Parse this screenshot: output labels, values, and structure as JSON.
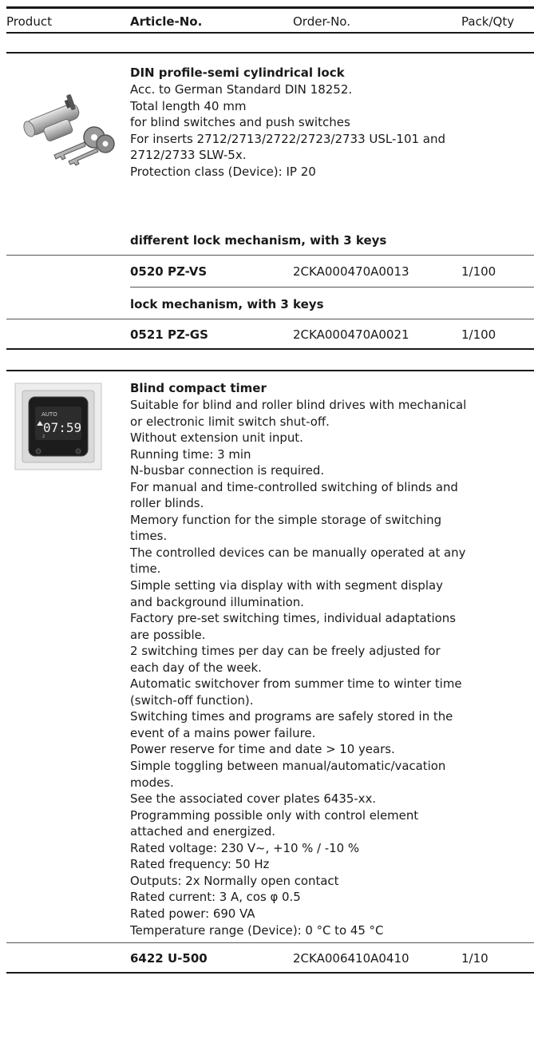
{
  "header": {
    "product": "Product",
    "article": "Article-No.",
    "order": "Order-No.",
    "pack": "Pack/Qty"
  },
  "products": [
    {
      "image_icon": "cylinder-lock-image",
      "title": "DIN profile-semi cylindrical lock",
      "lines": [
        "Acc. to German Standard DIN 18252.",
        "Total length 40 mm",
        "for blind switches and push switches",
        "For inserts 2712/2713/2722/2723/2733 USL-101 and",
        "2712/2733 SLW-5x.",
        "Protection class (Device): IP 20"
      ],
      "variants": [
        {
          "subtitle": "different lock mechanism, with 3 keys",
          "article": "0520 PZ-VS",
          "order": "2CKA000470A0013",
          "pack": "1/100"
        },
        {
          "subtitle": "lock mechanism, with 3 keys",
          "article": "0521 PZ-GS",
          "order": "2CKA000470A0021",
          "pack": "1/100"
        }
      ]
    },
    {
      "image_icon": "blind-timer-image",
      "display_label": "AUTO",
      "display_time": "07:59",
      "title": "Blind compact timer",
      "lines": [
        "Suitable for blind and roller blind drives with mechanical",
        "or electronic limit switch shut-off.",
        "Without extension unit input.",
        "Running time: 3 min",
        "N-busbar connection is required.",
        "For manual and time-controlled switching of blinds and",
        "roller blinds.",
        "Memory function for the simple storage of switching",
        "times.",
        "The controlled devices can be manually operated at any",
        "time.",
        "Simple setting via display with with segment display",
        "and background illumination.",
        "Factory pre-set switching times, individual adaptations",
        "are possible.",
        "2 switching times per day can be freely adjusted for",
        "each day of the week.",
        "Automatic switchover from summer time to winter time",
        "(switch-off function).",
        "Switching times and programs are safely stored in the",
        "event of a mains power failure.",
        "Power reserve for time and date > 10 years.",
        "Simple toggling between manual/automatic/vacation",
        "modes.",
        "See the associated cover plates 6435-xx.",
        "Programming possible only with control element",
        "attached and energized.",
        "Rated voltage: 230 V~, +10 % / -10 %",
        "Rated frequency: 50 Hz",
        "Outputs: 2x Normally open contact",
        "Rated current: 3 A, cos φ 0.5",
        "Rated power: 690 VA",
        "Temperature range (Device): 0 °C to 45 °C"
      ],
      "variants": [
        {
          "article": "6422 U-500",
          "order": "2CKA006410A0410",
          "pack": "1/10"
        }
      ]
    }
  ]
}
